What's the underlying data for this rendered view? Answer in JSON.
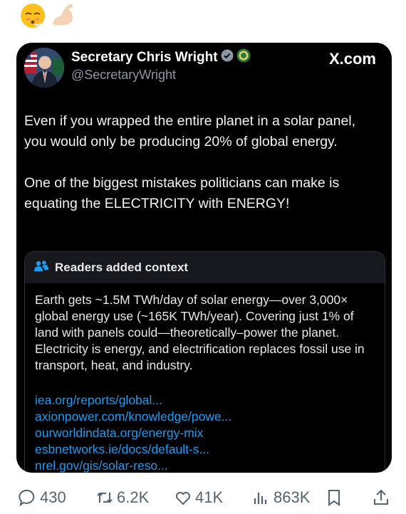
{
  "emojis": [
    "face-exhaling-emoji",
    "flexed-biceps-emoji"
  ],
  "post": {
    "author_name": "Secretary Chris Wright",
    "author_handle": "@SecretaryWright",
    "brand": "X.com",
    "paragraphs": [
      "Even if you wrapped the entire planet in a solar panel, you would only be producing 20% of global energy.",
      "One of the biggest mistakes politicians can make is equating the ELECTRICITY with ENERGY!"
    ]
  },
  "context": {
    "title": "Readers added context",
    "body": "Earth gets ~1.5M TWh/day of solar energy—over 3,000× global energy use (~165K TWh/year). Covering just 1% of land with panels could—theoretically–power the planet. Electricity is energy, and electrification replaces fossil use in transport, heat, and industry.",
    "links": [
      "iea.org/reports/global...",
      "axionpower.com/knowledge/powe...",
      "ourworldindata.org/energy-mix",
      "esbnetworks.ie/docs/default-s...",
      "nrel.gov/gis/solar-reso..."
    ]
  },
  "actions": {
    "replies": "430",
    "reposts": "6.2K",
    "likes": "41K",
    "views": "863K"
  },
  "colors": {
    "card_bg": "#000000",
    "link": "#1d9bf0",
    "muted": "#536471",
    "verified": "#8b98a5"
  }
}
